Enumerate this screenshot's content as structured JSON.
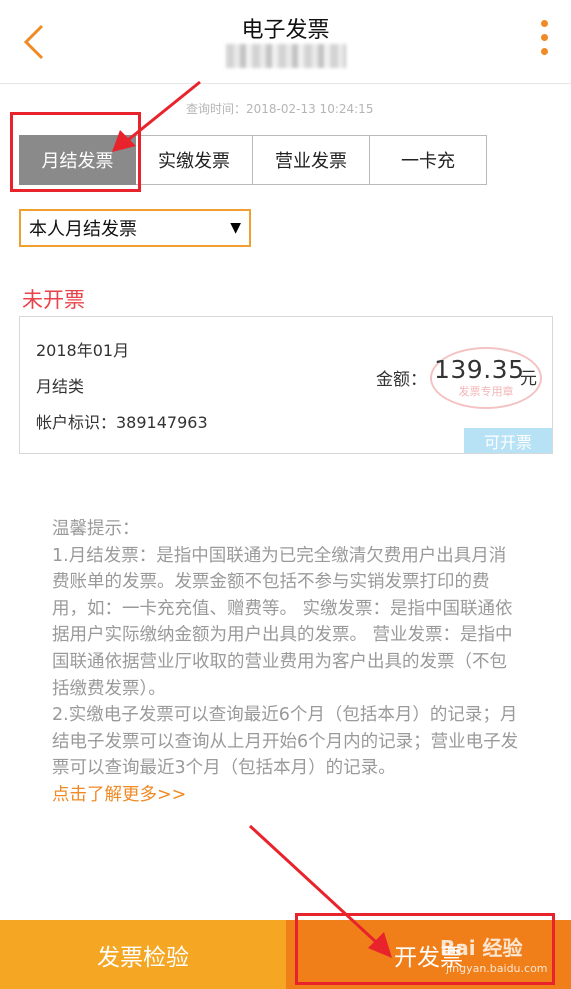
{
  "header": {
    "title": "电子发票",
    "back_icon": "chevron-left-icon",
    "more_icon": "more-vertical-icon",
    "accent_color": "#f08a24"
  },
  "query_time": "查询时间：2018-02-13 10:24:15",
  "tabs": [
    {
      "label": "月结发票",
      "active": true
    },
    {
      "label": "实缴发票",
      "active": false
    },
    {
      "label": "营业发票",
      "active": false
    },
    {
      "label": "一卡充",
      "active": false
    }
  ],
  "dropdown": {
    "selected": "本人月结发票"
  },
  "status_title": "未开票",
  "invoice": {
    "month": "2018年01月",
    "type": "月结类",
    "account": "帐户标识：389147963",
    "amount_label": "金额：",
    "amount": "139.35",
    "unit": "元",
    "stamp_text": "发票专用章",
    "badge": "可开票"
  },
  "tips": {
    "heading": "温馨提示：",
    "body": "1.月结发票：是指中国联通为已完全缴清欠费用户出具月消费账单的发票。发票金额不包括不参与实销发票打印的费用，如：一卡充充值、赠费等。 实缴发票：是指中国联通依据用户实际缴纳金额为用户出具的发票。 营业发票：是指中国联通依据营业厅收取的营业费用为客户出具的发票（不包括缴费发票）。\n2.实缴电子发票可以查询最近6个月（包括本月）的记录；月结电子发票可以查询从上月开始6个月内的记录；营业电子发票可以查询最近3个月（包括本月）的记录。",
    "link": "点击了解更多>>"
  },
  "bottom": {
    "verify_label": "发票检验",
    "issue_label": "开发票"
  },
  "watermark": {
    "main": "Bai 经验",
    "sub": "jingyan.baidu.com"
  }
}
